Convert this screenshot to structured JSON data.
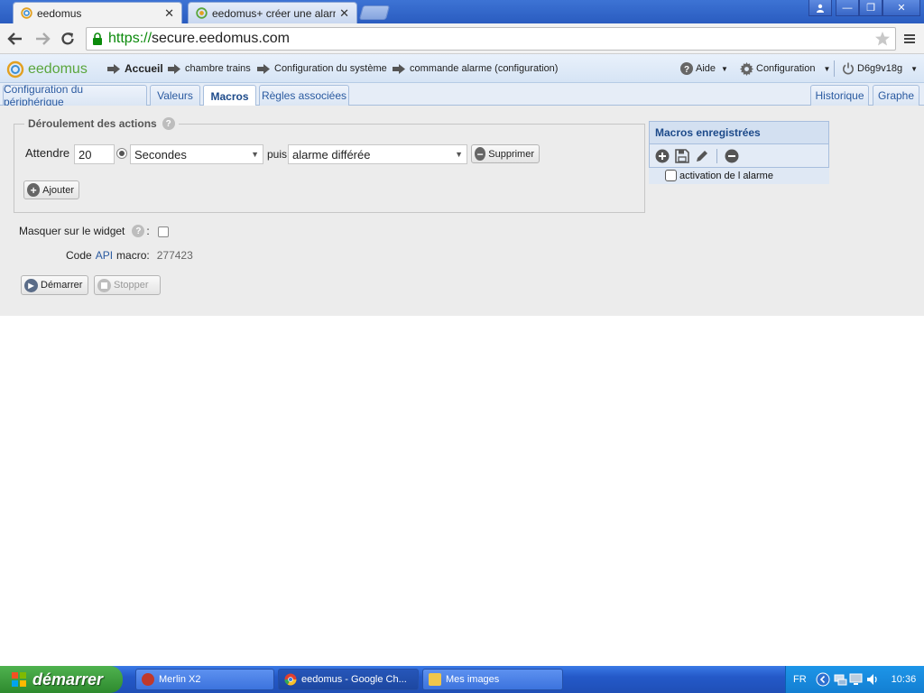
{
  "browser": {
    "tabs": [
      {
        "label": "eedomus",
        "active": true
      },
      {
        "label": "eedomus+ créer une alarme",
        "active": false
      }
    ],
    "url_scheme": "https://",
    "url_host": "secure.eedomus.com"
  },
  "app": {
    "logo_text": "eedomus",
    "breadcrumb": [
      "Accueil",
      "chambre trains",
      "Configuration du système",
      "commande alarme (configuration)"
    ],
    "menu": {
      "help": "Aide",
      "config": "Configuration",
      "user": "D6g9v18g"
    }
  },
  "subtabs": {
    "left": [
      {
        "label": "Configuration du périphérique",
        "active": false
      },
      {
        "label": "Valeurs",
        "active": false
      },
      {
        "label": "Macros",
        "active": true
      },
      {
        "label": "Règles associées",
        "active": false
      }
    ],
    "right": [
      {
        "label": "Historique"
      },
      {
        "label": "Graphe"
      }
    ]
  },
  "actions": {
    "legend": "Déroulement des actions",
    "wait_label": "Attendre",
    "wait_value": "20",
    "unit_value": "Secondes",
    "then_label": "puis",
    "action_value": "alarme différée",
    "delete_label": "Supprimer",
    "add_label": "Ajouter"
  },
  "widget": {
    "hide_label": "Masquer sur le widget",
    "colon": ":",
    "code_label_prefix": "Code",
    "code_label_api": "API",
    "code_label_suffix": "macro:",
    "code_value": "277423"
  },
  "controls": {
    "start_label": "Démarrer",
    "stop_label": "Stopper"
  },
  "macros_panel": {
    "title": "Macros enregistrées",
    "items": [
      "activation de l alarme"
    ]
  },
  "taskbar": {
    "start_label": "démarrer",
    "tasks": [
      {
        "label": "Merlin X2"
      },
      {
        "label": "eedomus - Google Ch..."
      },
      {
        "label": "Mes images"
      }
    ],
    "lang": "FR",
    "clock": "10:36"
  },
  "colors": {
    "accent": "#1d4a8a",
    "logo": "#5aa63c",
    "url_scheme": "#0b8a0b"
  }
}
